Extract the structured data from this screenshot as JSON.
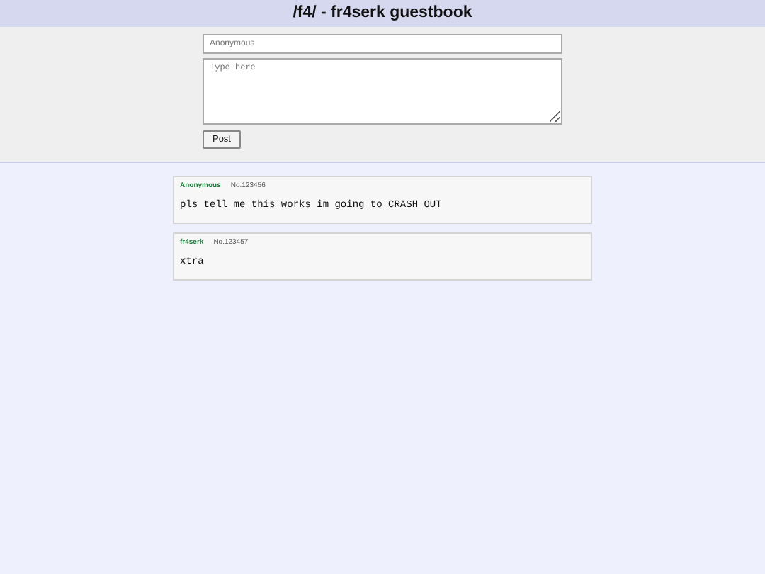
{
  "header": {
    "title": "/f4/ - fr4serk guestbook"
  },
  "form": {
    "name_field": {
      "placeholder": "Anonymous"
    },
    "message_field": {
      "placeholder": "Type here"
    },
    "submit_button": "Post"
  },
  "posts": [
    {
      "author": "Anonymous",
      "number": "No.123456",
      "message": "pls tell me this works im going to CRASH OUT"
    },
    {
      "author": "fr4serk",
      "number": "No.123457",
      "message": "xtra"
    }
  ]
}
